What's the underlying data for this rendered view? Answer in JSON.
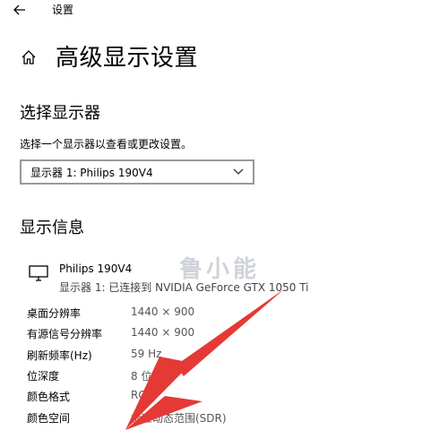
{
  "header": {
    "app_title": "设置"
  },
  "page": {
    "title": "高级显示设置"
  },
  "select_display": {
    "heading": "选择显示器",
    "description": "选择一个显示器以查看或更改设置。",
    "dropdown_value": "显示器 1: Philips 190V4"
  },
  "display_info": {
    "heading": "显示信息",
    "monitor_name": "Philips 190V4",
    "connection": "显示器 1: 已连接到 NVIDIA GeForce GTX 1050 Ti",
    "rows": [
      {
        "label": "桌面分辨率",
        "value": "1440 × 900"
      },
      {
        "label": "有源信号分辨率",
        "value": "1440 × 900"
      },
      {
        "label": "刷新频率(Hz)",
        "value": "59 Hz"
      },
      {
        "label": "位深度",
        "value": "8 位"
      },
      {
        "label": "颜色格式",
        "value": "RGB"
      },
      {
        "label": "颜色空间",
        "value": "标准动态范围(SDR)"
      }
    ]
  },
  "watermark": "鲁小能",
  "colors": {
    "arrow": "#e53935",
    "text_secondary": "#555555",
    "border": "#999999"
  },
  "icons": [
    "back-arrow-icon",
    "home-icon",
    "chevron-down-icon",
    "monitor-icon"
  ]
}
